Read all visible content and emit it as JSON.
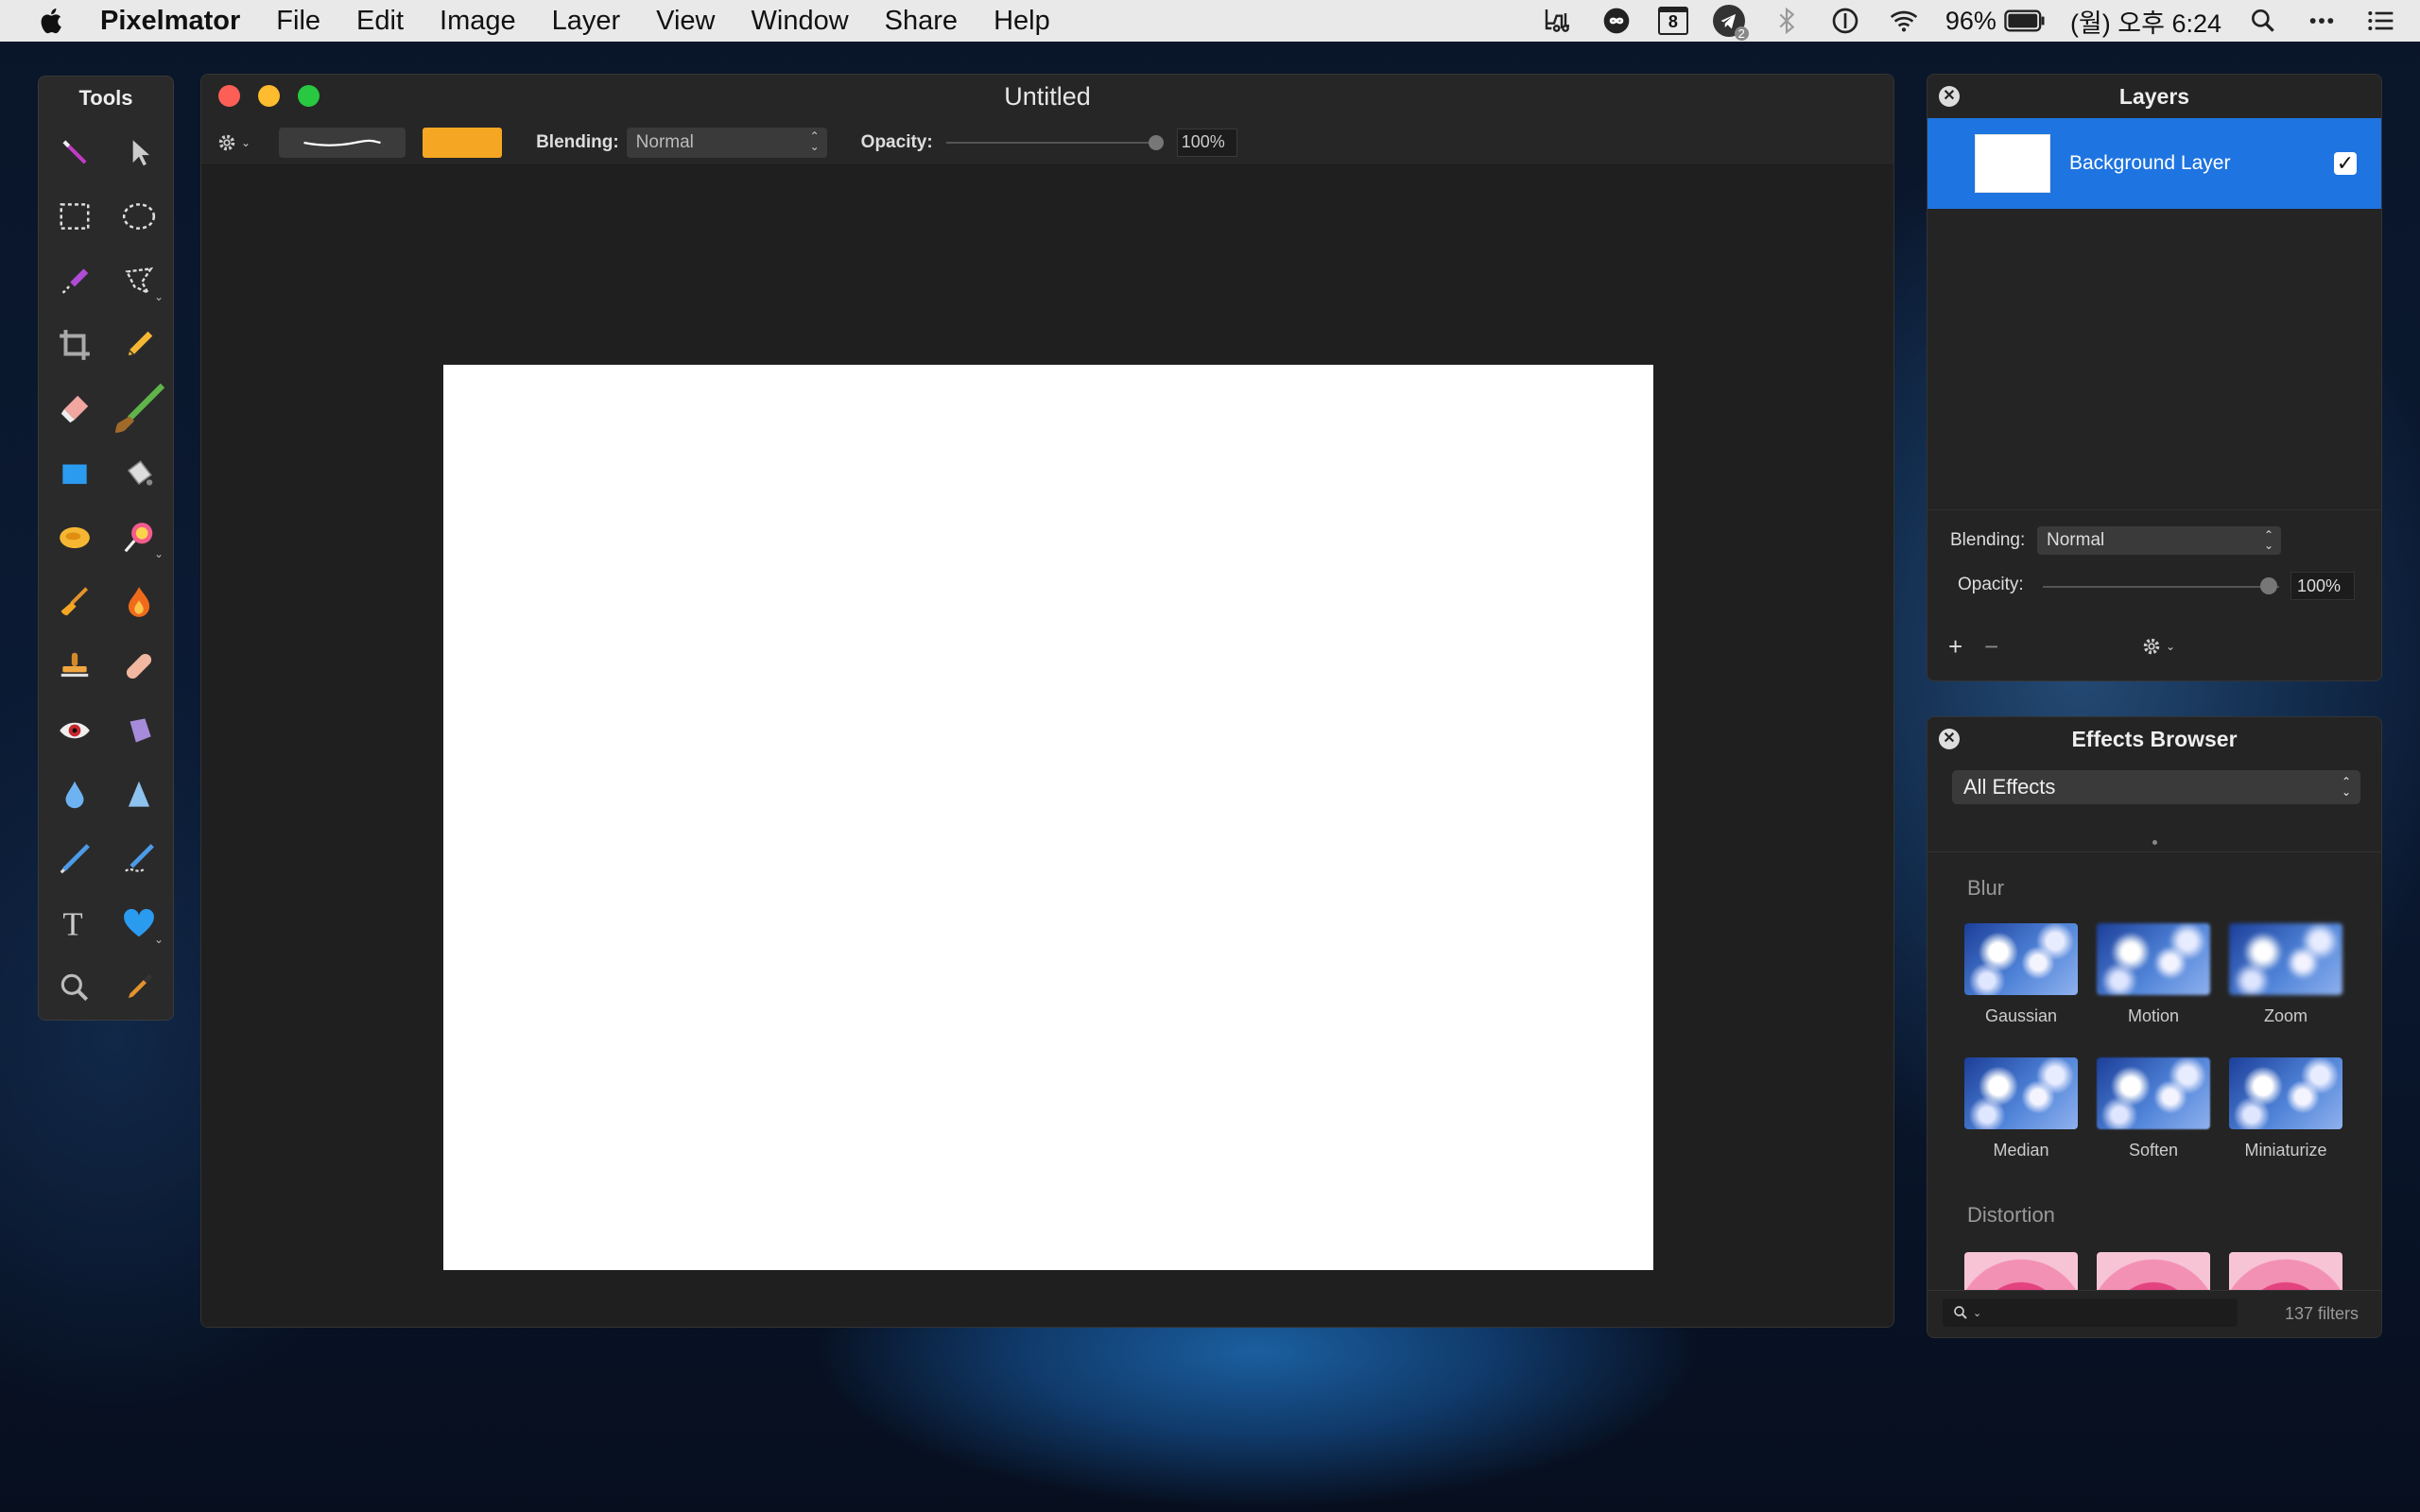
{
  "menubar": {
    "app_name": "Pixelmator",
    "menus": [
      "File",
      "Edit",
      "Image",
      "Layer",
      "View",
      "Window",
      "Share",
      "Help"
    ],
    "battery": "96%",
    "clock": "(월) 오후 6:24",
    "calendar_day": "8",
    "badge_count": "2"
  },
  "tools_panel": {
    "title": "Tools",
    "tools": [
      "magic-wand",
      "arrow-select",
      "rect-select",
      "ellipse-select",
      "quick-select",
      "lasso",
      "crop",
      "pencil",
      "eraser",
      "paintbrush",
      "rectangle-shape",
      "paint-bucket",
      "color-blob",
      "gradient",
      "smudge",
      "burn",
      "stamp",
      "heal",
      "red-eye",
      "sponge",
      "blur-drop",
      "sharpen",
      "pen",
      "freeform-pen",
      "type",
      "heart-shape",
      "zoom",
      "eyedropper"
    ]
  },
  "document": {
    "title": "Untitled",
    "toolbar": {
      "blending_label": "Blending:",
      "blending_value": "Normal",
      "opacity_label": "Opacity:",
      "opacity_value": "100%",
      "opacity_fraction": 1.0,
      "color": "#f5a623"
    }
  },
  "layers_panel": {
    "title": "Layers",
    "layer_name": "Background Layer",
    "layer_visible": "✓",
    "blending_label": "Blending:",
    "blending_value": "Normal",
    "opacity_label": "Opacity:",
    "opacity_value": "100%",
    "add": "+",
    "remove": "−"
  },
  "effects_panel": {
    "title": "Effects Browser",
    "category_select": "All Effects",
    "group_blur": "Blur",
    "blur_effects": [
      "Gaussian",
      "Motion",
      "Zoom",
      "Median",
      "Soften",
      "Miniaturize"
    ],
    "group_distortion": "Distortion",
    "filter_count": "137 filters"
  },
  "colors": {
    "accent_blue": "#1e74e0",
    "close_red": "#fd5f57",
    "minimize_yellow": "#febc2e",
    "zoom_green": "#28c840",
    "swatch_orange": "#f5a623"
  }
}
